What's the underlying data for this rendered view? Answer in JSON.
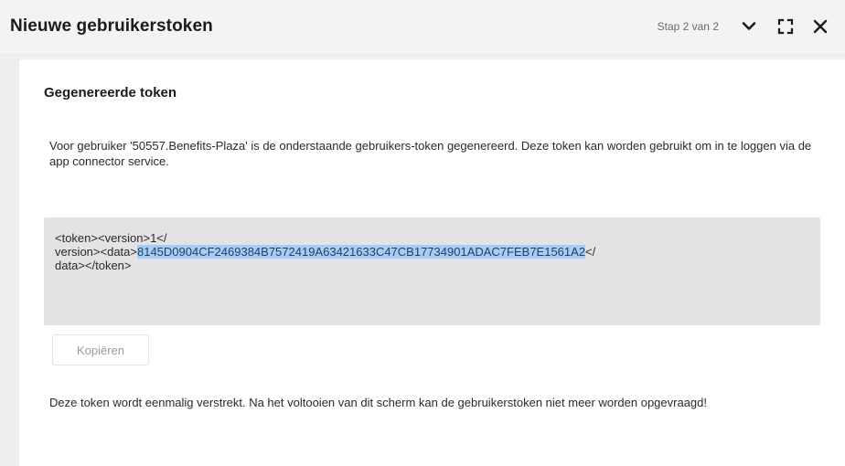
{
  "dialog": {
    "title": "Nieuwe gebruikerstoken",
    "step": "Stap 2 van 2",
    "icons": {
      "collapse": "chevron-down-icon",
      "expand": "fullscreen-icon",
      "close": "close-icon"
    }
  },
  "content": {
    "section_title": "Gegenereerde token",
    "intro": "Voor gebruiker '50557.Benefits-Plaza' is de onderstaande gebruikers-token gegenereerd. Deze token kan worden gebruikt om in te loggen via de app connector service.",
    "token": {
      "prefix": "<token><version>1</version><data>",
      "value": "8145D0904CF2469384B7572419A63421633C47CB17734901ADAC7FEB7E1561A2",
      "suffix": "</data></token>",
      "line1": "<token><version>1</",
      "line2_start": "version><data>"
    },
    "copy_button": "Kopiëren",
    "footnote": "Deze token wordt eenmalig verstrekt. Na het voltooien van dit scherm kan de gebruikerstoken niet meer worden opgevraagd!"
  }
}
